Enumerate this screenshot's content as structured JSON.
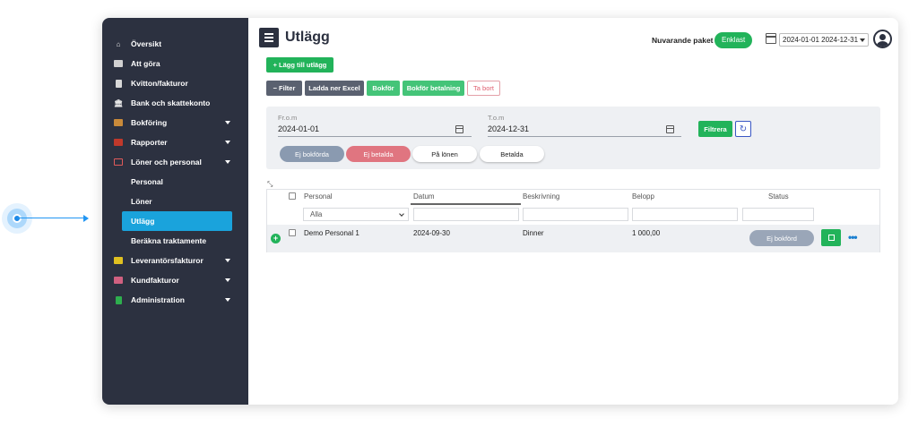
{
  "sidebar": {
    "items": [
      {
        "label": "Översikt",
        "icon": "home-icon"
      },
      {
        "label": "Att göra",
        "icon": "list-icon"
      },
      {
        "label": "Kvitton/fakturor",
        "icon": "receipt-icon"
      },
      {
        "label": "Bank och skattekonto",
        "icon": "bank-icon"
      },
      {
        "label": "Bokföring",
        "icon": "book-icon"
      },
      {
        "label": "Rapporter",
        "icon": "chart-icon"
      },
      {
        "label": "Löner och personal",
        "icon": "card-icon"
      }
    ],
    "sub_items": [
      {
        "label": "Personal"
      },
      {
        "label": "Löner"
      },
      {
        "label": "Utlägg"
      },
      {
        "label": "Beräkna traktamente"
      }
    ],
    "items_bottom": [
      {
        "label": "Leverantörsfakturor",
        "icon": "supplier-icon"
      },
      {
        "label": "Kundfakturor",
        "icon": "customer-icon"
      },
      {
        "label": "Administration",
        "icon": "admin-icon"
      }
    ]
  },
  "header": {
    "title": "Utlägg",
    "package_label": "Nuvarande paket",
    "package_value": "Enklast",
    "date_range": "2024-01-01 2024-12-31"
  },
  "toolbar": {
    "add_label": "+ Lägg till utlägg",
    "filter_label": "− Filter",
    "excel_label": "Ladda ner Excel",
    "bokfor_label": "Bokför",
    "bokfor_betalning_label": "Bokför betalning",
    "tabort_label": "Ta bort"
  },
  "filters": {
    "from_label": "Fr.o.m",
    "from_value": "2024-01-01",
    "to_label": "T.o.m",
    "to_value": "2024-12-31",
    "filtrera_label": "Filtrera",
    "refresh_glyph": "↻",
    "pills": [
      "Ej bokförda",
      "Ej betalda",
      "På lönen",
      "Betalda"
    ]
  },
  "table": {
    "columns": [
      "Personal",
      "Datum",
      "Beskrivning",
      "Belopp",
      "Status"
    ],
    "personal_filter": "Alla",
    "rows": [
      {
        "personal": "Demo Personal 1",
        "datum": "2024-09-30",
        "beskrivning": "Dinner",
        "belopp": "1 000,00",
        "status": "Ej bokförd"
      }
    ]
  },
  "colors": {
    "sidebar_bg": "#2c3140",
    "active": "#1aa3dc",
    "green": "#22b35a",
    "red_pill": "#e07580",
    "gray_pill": "#8a9ab0"
  }
}
